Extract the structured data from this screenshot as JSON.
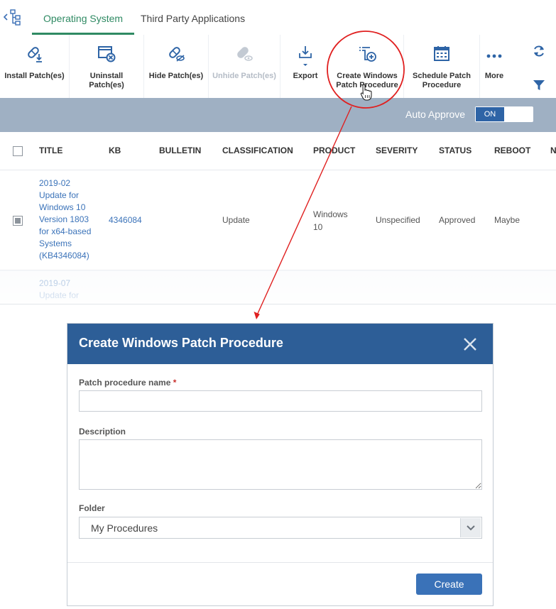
{
  "tabs": [
    {
      "label": "Operating System",
      "active": true
    },
    {
      "label": "Third Party Applications",
      "active": false
    }
  ],
  "toolbar": {
    "buttons": [
      {
        "label": "Install Patch(es)",
        "icon": "install-patch-icon",
        "enabled": true
      },
      {
        "label": "Uninstall\nPatch(es)",
        "icon": "uninstall-patch-icon",
        "enabled": true
      },
      {
        "label": "Hide Patch(es)",
        "icon": "hide-patch-icon",
        "enabled": true
      },
      {
        "label": "Unhide Patch(es)",
        "icon": "unhide-patch-icon",
        "enabled": false
      },
      {
        "label": "Export",
        "icon": "export-icon",
        "enabled": true
      },
      {
        "label": "Create Windows\nPatch Procedure",
        "icon": "create-procedure-icon",
        "enabled": true
      },
      {
        "label": "Schedule Patch\nProcedure",
        "icon": "calendar-icon",
        "enabled": true
      },
      {
        "label": "More",
        "icon": "more-dots-icon",
        "enabled": true
      }
    ],
    "refresh_icon": "refresh-icon",
    "filter_icon": "filter-icon"
  },
  "auto_approve": {
    "label": "Auto Approve",
    "state": "ON"
  },
  "table": {
    "columns": [
      "TITLE",
      "KB",
      "BULLETIN",
      "CLASSIFICATION",
      "PRODUCT",
      "SEVERITY",
      "STATUS",
      "REBOOT",
      "N"
    ],
    "rows": [
      {
        "title": "2019-02 Update for Windows 10 Version 1803 for x64-based Systems (KB4346084)",
        "title_lines": [
          "2019-02",
          "Update for",
          "Windows 10",
          "Version 1803",
          "for x64-based",
          "Systems",
          "(KB4346084)"
        ],
        "kb": "4346084",
        "bulletin": "",
        "classification": "Update",
        "product_lines": [
          "Windows",
          "10"
        ],
        "severity": "Unspecified",
        "status": "Approved",
        "reboot": "Maybe",
        "checked": true
      },
      {
        "title_lines": [
          "2019-07",
          "Update for"
        ]
      }
    ]
  },
  "dialog": {
    "title": "Create Windows Patch Procedure",
    "name_label": "Patch procedure name",
    "required_mark": "*",
    "name_value": "",
    "description_label": "Description",
    "description_value": "",
    "folder_label": "Folder",
    "folder_value": "My Procedures",
    "create_label": "Create"
  },
  "colors": {
    "accent_green": "#2f8a63",
    "link_blue": "#3b73b9",
    "dialog_header": "#2d5e97",
    "primary_button": "#3a72b8",
    "annotation_red": "#e02020",
    "gray_bar": "#9fb0c3"
  }
}
